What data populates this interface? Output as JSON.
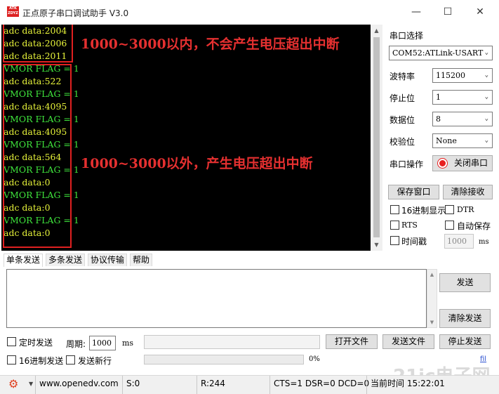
{
  "window": {
    "logo_text": "ATK ZDYZ",
    "title": "正点原子串口调试助手 V3.0",
    "minimize_glyph": "—",
    "maximize_glyph": "☐",
    "close_glyph": "✕"
  },
  "terminal": {
    "lines": [
      "adc data:2004",
      "adc data:2006",
      "adc data:2011",
      "VMOR FLAG = 1",
      "adc data:522",
      "VMOR FLAG = 1",
      "adc data:4095",
      "VMOR FLAG = 1",
      "adc data:4095",
      "VMOR FLAG = 1",
      "adc data:564",
      "VMOR FLAG = 1",
      "adc data:0",
      "VMOR FLAG = 1",
      "adc data:0",
      "VMOR FLAG = 1",
      "adc data:0"
    ],
    "note_top": "1000~3000以内，不会产生电压超出中断",
    "note_bottom": "1000~3000以外，产生电压超出中断",
    "text_color": "#e6f23a",
    "flag_color": "#3fe43c",
    "annotation_color": "#e02020"
  },
  "settings": {
    "port_label": "串口选择",
    "port_value": "COM52:ATLink-USART",
    "baud_label": "波特率",
    "baud_value": "115200",
    "stop_label": "停止位",
    "stop_value": "1",
    "data_label": "数据位",
    "data_value": "8",
    "parity_label": "校验位",
    "parity_value": "None",
    "op_label": "串口操作",
    "close_port_button": "关闭串口",
    "save_window_button": "保存窗口",
    "clear_recv_button": "清除接收",
    "hex_display": "16进制显示",
    "dtr": "DTR",
    "rts": "RTS",
    "auto_save": "自动保存",
    "timestamp": "时间戳",
    "timestamp_value": "1000",
    "timestamp_unit": "ms"
  },
  "tabs": [
    "单条发送",
    "多条发送",
    "协议传输",
    "帮助"
  ],
  "send": {
    "send_button": "发送",
    "clear_send_button": "清除发送",
    "timed_send": "定时发送",
    "period_label": "周期:",
    "period_value": "1000",
    "period_unit": "ms",
    "open_file_button": "打开文件",
    "send_file_button": "发送文件",
    "stop_send_button": "停止发送",
    "hex_send": "16进制发送",
    "send_newline": "发送新行",
    "progress_percent": "0%",
    "progress_value": 0
  },
  "status": {
    "gear_icon": "gear-icon",
    "url": "www.openedv.com",
    "sent": "S:0",
    "received": "R:244",
    "signals": "CTS=1 DSR=0 DCD=0",
    "time_label": "当前时间",
    "time": "15:22:01"
  },
  "watermark": "21ic电子网"
}
